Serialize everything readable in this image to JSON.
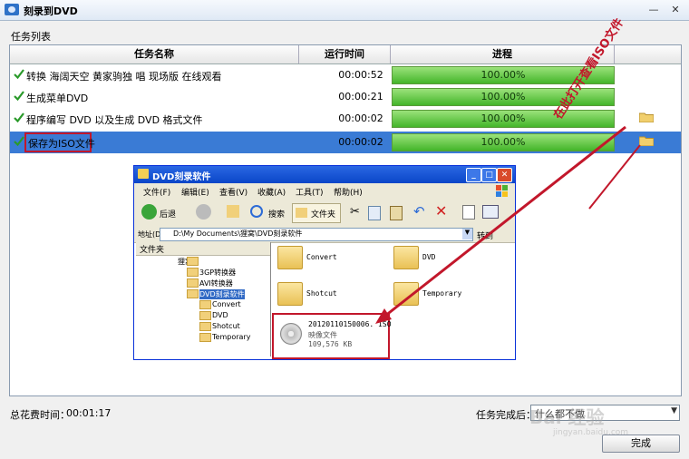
{
  "window": {
    "title": "刻录到DVD"
  },
  "task_list_label": "任务列表",
  "columns": {
    "name": "任务名称",
    "time": "运行时间",
    "progress": "进程"
  },
  "tasks": [
    {
      "name": "转换 海阔天空 黄家驹独 唱 现场版 在线观看",
      "time": "00:00:52",
      "progress": "100.00%"
    },
    {
      "name": "生成菜单DVD",
      "time": "00:00:21",
      "progress": "100.00%"
    },
    {
      "name": "程序编写 DVD 以及生成 DVD 格式文件",
      "time": "00:00:02",
      "progress": "100.00%"
    },
    {
      "name": "保存为ISO文件",
      "time": "00:00:02",
      "progress": "100.00%"
    }
  ],
  "footer": {
    "total_label": "总花费时间：",
    "total_value": "00:01:17",
    "after_label": "任务完成后：",
    "after_value": "什么都不做",
    "done_button": "完成"
  },
  "annotation": "在此打开查看ISO文件",
  "explorer": {
    "title": "DVD刻录软件",
    "menu": [
      "文件(F)",
      "编辑(E)",
      "查看(V)",
      "收藏(A)",
      "工具(T)",
      "帮助(H)"
    ],
    "toolbar": {
      "back": "后退",
      "search": "搜索",
      "folders": "文件夹"
    },
    "address_label": "地址(D)",
    "address": "D:\\My Documents\\狸窝\\DVD刻录软件",
    "go": "转到",
    "tree_header": "文件夹",
    "tree": [
      "狸窝",
      "3GP转换器",
      "AVI转换器",
      "DVD刻录软件",
      "Convert",
      "DVD",
      "Shotcut",
      "Temporary",
      "... "
    ],
    "folders": [
      "Convert",
      "DVD",
      "Shotcut",
      "Temporary"
    ],
    "iso": {
      "name": "20120110150006. ISO",
      "type": "映像文件",
      "size": "109,576 KB"
    }
  },
  "watermark": "Bai 经验",
  "watermark_sub": "jingyan.baidu.com",
  "colors": {
    "selection": "#3a7bd5",
    "progress": "#44b52a",
    "annotation": "#c2172b"
  }
}
